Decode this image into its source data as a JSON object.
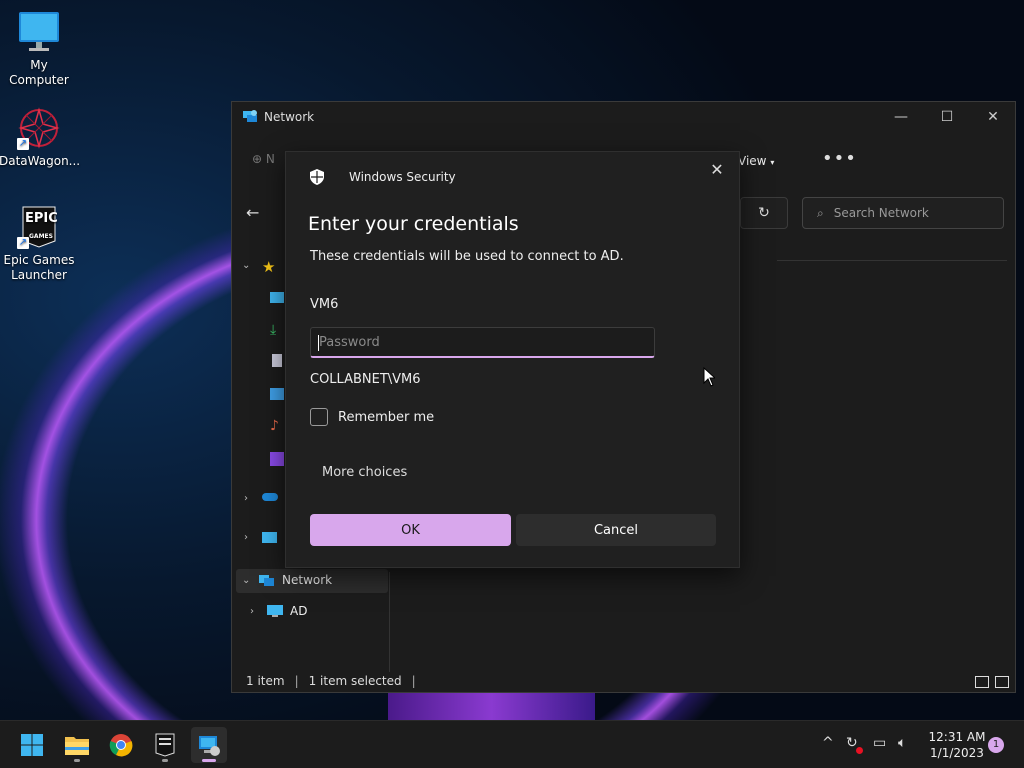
{
  "desktop": {
    "icons": [
      {
        "label": "My Computer"
      },
      {
        "label": "DataWagon..."
      },
      {
        "label": "Epic Games Launcher"
      }
    ],
    "epic_logo_text": "EPIC",
    "epic_logo_sub": "GAMES"
  },
  "explorer": {
    "title": "Network",
    "toolbar": {
      "view_label": "View",
      "new_label": "N"
    },
    "search_placeholder": "Search Network",
    "nav": {
      "network_label": "Network",
      "ad_label": "AD"
    },
    "status": {
      "items_count": "1 item",
      "selected_count": "1 item selected"
    }
  },
  "dialog": {
    "app_name": "Windows Security",
    "heading": "Enter your credentials",
    "description": "These credentials will be used to connect to AD.",
    "username": "VM6",
    "password_placeholder": "Password",
    "domain_user": "COLLABNET\\VM6",
    "remember_label": "Remember me",
    "remember_checked": false,
    "more_choices_label": "More choices",
    "ok_label": "OK",
    "cancel_label": "Cancel"
  },
  "taskbar": {
    "apps": [
      "start-icon",
      "file-explorer-icon",
      "chrome-icon",
      "epic-games-icon",
      "network-security-icon"
    ],
    "clock_time": "12:31 AM",
    "clock_date": "1/1/2023",
    "notification_count": "1"
  },
  "colors": {
    "accent": "#d8a7ec",
    "dialog_bg": "#202020",
    "window_bg": "#1c1c1c"
  }
}
